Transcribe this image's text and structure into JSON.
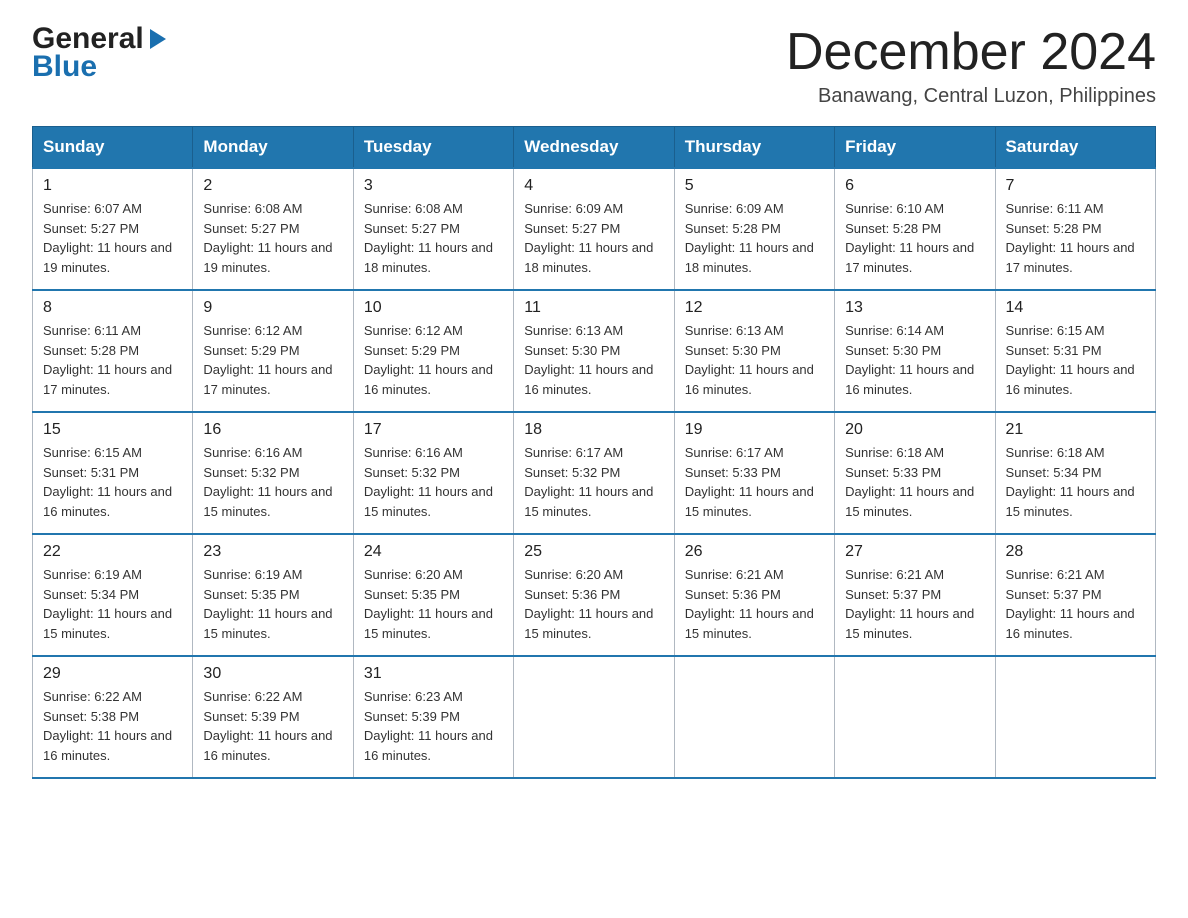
{
  "header": {
    "month_year": "December 2024",
    "location": "Banawang, Central Luzon, Philippines",
    "logo_line1": "General",
    "logo_line2": "Blue"
  },
  "weekdays": [
    "Sunday",
    "Monday",
    "Tuesday",
    "Wednesday",
    "Thursday",
    "Friday",
    "Saturday"
  ],
  "weeks": [
    [
      {
        "day": "1",
        "sunrise": "6:07 AM",
        "sunset": "5:27 PM",
        "daylight": "11 hours and 19 minutes."
      },
      {
        "day": "2",
        "sunrise": "6:08 AM",
        "sunset": "5:27 PM",
        "daylight": "11 hours and 19 minutes."
      },
      {
        "day": "3",
        "sunrise": "6:08 AM",
        "sunset": "5:27 PM",
        "daylight": "11 hours and 18 minutes."
      },
      {
        "day": "4",
        "sunrise": "6:09 AM",
        "sunset": "5:27 PM",
        "daylight": "11 hours and 18 minutes."
      },
      {
        "day": "5",
        "sunrise": "6:09 AM",
        "sunset": "5:28 PM",
        "daylight": "11 hours and 18 minutes."
      },
      {
        "day": "6",
        "sunrise": "6:10 AM",
        "sunset": "5:28 PM",
        "daylight": "11 hours and 17 minutes."
      },
      {
        "day": "7",
        "sunrise": "6:11 AM",
        "sunset": "5:28 PM",
        "daylight": "11 hours and 17 minutes."
      }
    ],
    [
      {
        "day": "8",
        "sunrise": "6:11 AM",
        "sunset": "5:28 PM",
        "daylight": "11 hours and 17 minutes."
      },
      {
        "day": "9",
        "sunrise": "6:12 AM",
        "sunset": "5:29 PM",
        "daylight": "11 hours and 17 minutes."
      },
      {
        "day": "10",
        "sunrise": "6:12 AM",
        "sunset": "5:29 PM",
        "daylight": "11 hours and 16 minutes."
      },
      {
        "day": "11",
        "sunrise": "6:13 AM",
        "sunset": "5:30 PM",
        "daylight": "11 hours and 16 minutes."
      },
      {
        "day": "12",
        "sunrise": "6:13 AM",
        "sunset": "5:30 PM",
        "daylight": "11 hours and 16 minutes."
      },
      {
        "day": "13",
        "sunrise": "6:14 AM",
        "sunset": "5:30 PM",
        "daylight": "11 hours and 16 minutes."
      },
      {
        "day": "14",
        "sunrise": "6:15 AM",
        "sunset": "5:31 PM",
        "daylight": "11 hours and 16 minutes."
      }
    ],
    [
      {
        "day": "15",
        "sunrise": "6:15 AM",
        "sunset": "5:31 PM",
        "daylight": "11 hours and 16 minutes."
      },
      {
        "day": "16",
        "sunrise": "6:16 AM",
        "sunset": "5:32 PM",
        "daylight": "11 hours and 15 minutes."
      },
      {
        "day": "17",
        "sunrise": "6:16 AM",
        "sunset": "5:32 PM",
        "daylight": "11 hours and 15 minutes."
      },
      {
        "day": "18",
        "sunrise": "6:17 AM",
        "sunset": "5:32 PM",
        "daylight": "11 hours and 15 minutes."
      },
      {
        "day": "19",
        "sunrise": "6:17 AM",
        "sunset": "5:33 PM",
        "daylight": "11 hours and 15 minutes."
      },
      {
        "day": "20",
        "sunrise": "6:18 AM",
        "sunset": "5:33 PM",
        "daylight": "11 hours and 15 minutes."
      },
      {
        "day": "21",
        "sunrise": "6:18 AM",
        "sunset": "5:34 PM",
        "daylight": "11 hours and 15 minutes."
      }
    ],
    [
      {
        "day": "22",
        "sunrise": "6:19 AM",
        "sunset": "5:34 PM",
        "daylight": "11 hours and 15 minutes."
      },
      {
        "day": "23",
        "sunrise": "6:19 AM",
        "sunset": "5:35 PM",
        "daylight": "11 hours and 15 minutes."
      },
      {
        "day": "24",
        "sunrise": "6:20 AM",
        "sunset": "5:35 PM",
        "daylight": "11 hours and 15 minutes."
      },
      {
        "day": "25",
        "sunrise": "6:20 AM",
        "sunset": "5:36 PM",
        "daylight": "11 hours and 15 minutes."
      },
      {
        "day": "26",
        "sunrise": "6:21 AM",
        "sunset": "5:36 PM",
        "daylight": "11 hours and 15 minutes."
      },
      {
        "day": "27",
        "sunrise": "6:21 AM",
        "sunset": "5:37 PM",
        "daylight": "11 hours and 15 minutes."
      },
      {
        "day": "28",
        "sunrise": "6:21 AM",
        "sunset": "5:37 PM",
        "daylight": "11 hours and 16 minutes."
      }
    ],
    [
      {
        "day": "29",
        "sunrise": "6:22 AM",
        "sunset": "5:38 PM",
        "daylight": "11 hours and 16 minutes."
      },
      {
        "day": "30",
        "sunrise": "6:22 AM",
        "sunset": "5:39 PM",
        "daylight": "11 hours and 16 minutes."
      },
      {
        "day": "31",
        "sunrise": "6:23 AM",
        "sunset": "5:39 PM",
        "daylight": "11 hours and 16 minutes."
      },
      null,
      null,
      null,
      null
    ]
  ],
  "labels": {
    "sunrise": "Sunrise:",
    "sunset": "Sunset:",
    "daylight": "Daylight:"
  }
}
